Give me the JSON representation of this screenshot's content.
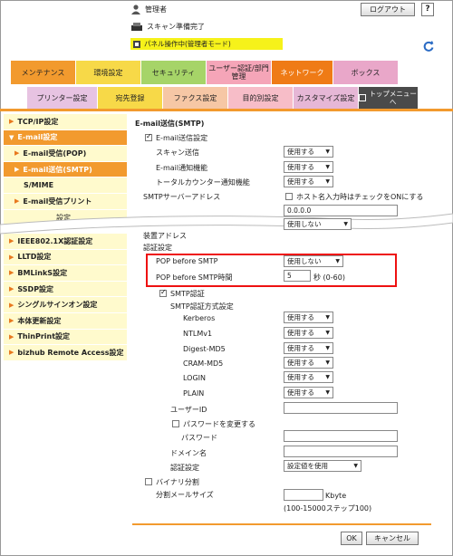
{
  "header": {
    "user": "管理者",
    "logout": "ログアウト",
    "help": "?",
    "status_scan": "スキャン準備完了",
    "status_panel": "パネル操作中(管理者モード)"
  },
  "tabs_main": [
    {
      "label": "メンテナンス",
      "color": "#f29a2e"
    },
    {
      "label": "環境設定",
      "color": "#f7d948"
    },
    {
      "label": "セキュリティ",
      "color": "#a6d468"
    },
    {
      "label": "ユーザー認証/部門管理",
      "color": "#f5a5b8"
    },
    {
      "label": "ネットワーク",
      "color": "#ef7b16"
    },
    {
      "label": "ボックス",
      "color": "#e9a7c9"
    }
  ],
  "tabs_sub": [
    {
      "label": "プリンター設定",
      "color": "#e7c3e2"
    },
    {
      "label": "宛先登録",
      "color": "#f7d948"
    },
    {
      "label": "ファクス設定",
      "color": "#f6c7a5"
    },
    {
      "label": "目的別設定",
      "color": "#f7bdc8"
    },
    {
      "label": "カスタマイズ設定",
      "color": "#e6b7d6"
    },
    {
      "label": "トップメニューへ",
      "color": "#4a4a4a"
    }
  ],
  "sidebar": [
    {
      "label": "TCP/IP設定",
      "level": "top",
      "active": false
    },
    {
      "label": "E-mail設定",
      "level": "top",
      "active": true
    },
    {
      "label": "E-mail受信(POP)",
      "level": "sub",
      "active": false
    },
    {
      "label": "E-mail送信(SMTP)",
      "level": "sub",
      "active": true
    },
    {
      "label": "S/MIME",
      "level": "sub",
      "active": false
    },
    {
      "label": "E-mail受信プリント",
      "level": "sub",
      "active": false
    },
    {
      "label": "IEEE802.1X認証設定",
      "level": "top",
      "active": false
    },
    {
      "label": "LLTD設定",
      "level": "top",
      "active": false
    },
    {
      "label": "BMLinkS設定",
      "level": "top",
      "active": false
    },
    {
      "label": "SSDP設定",
      "level": "top",
      "active": false
    },
    {
      "label": "シングルサインオン設定",
      "level": "top",
      "active": false
    },
    {
      "label": "本体更新設定",
      "level": "top",
      "active": false
    },
    {
      "label": "ThinPrint設定",
      "level": "top",
      "active": false
    },
    {
      "label": "bizhub Remote Access設定",
      "level": "top",
      "active": false
    }
  ],
  "sidebar_partial": "設定",
  "form": {
    "title": "E-mail送信(SMTP)",
    "email_send": "E-mail送信設定",
    "scan_send": "スキャン送信",
    "scan_send_value": "使用する",
    "notify": "E-mail通知機能",
    "notify_value": "使用する",
    "total_counter": "トータルカウンター通知機能",
    "total_counter_value": "使用する",
    "smtp_server": "SMTPサーバーアドレス",
    "host_note": "ホスト名入力時はチェックをONにする",
    "server_value": "0.0.0.0",
    "partial_value": "使用しない",
    "partial_label1": "装置アドレス",
    "partial_label2": "認証設定",
    "pop_before_smtp": "POP before SMTP",
    "pop_before_smtp_value": "使用しない",
    "pop_time": "POP before SMTP時間",
    "pop_time_value": "5",
    "pop_time_unit": "秒 (0-60)",
    "smtp_auth": "SMTP認証",
    "smtp_auth_method": "SMTP認証方式設定",
    "methods": [
      {
        "label": "Kerberos",
        "value": "使用する"
      },
      {
        "label": "NTLMv1",
        "value": "使用する"
      },
      {
        "label": "Digest-MD5",
        "value": "使用する"
      },
      {
        "label": "CRAM-MD5",
        "value": "使用する"
      },
      {
        "label": "LOGIN",
        "value": "使用する"
      },
      {
        "label": "PLAIN",
        "value": "使用する"
      }
    ],
    "user_id": "ユーザーID",
    "change_password": "パスワードを変更する",
    "password": "パスワード",
    "domain": "ドメイン名",
    "auth_setting": "認証設定",
    "auth_setting_value": "設定値を使用",
    "binary_split": "バイナリ分割",
    "split_size": "分割メールサイズ",
    "split_unit": "Kbyte",
    "split_range": "(100-15000ステップ100)"
  },
  "buttons": {
    "ok": "OK",
    "cancel": "キャンセル"
  }
}
